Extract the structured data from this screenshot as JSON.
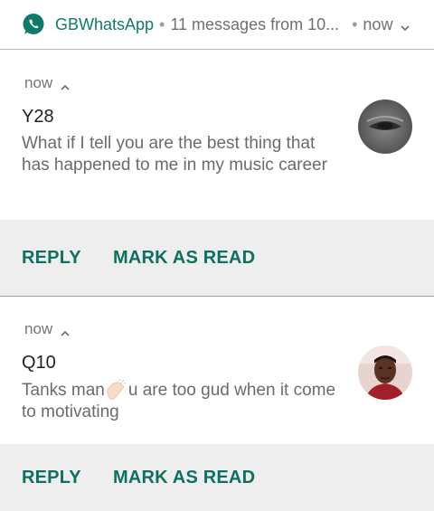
{
  "header": {
    "app_name": "GBWhatsApp",
    "separator": "•",
    "summary": "11 messages from 10...",
    "time": "now",
    "icon": "whatsapp-logo-icon",
    "accent_color": "#0f7a6a"
  },
  "notifications": [
    {
      "time": "now",
      "sender": "Y28",
      "message": "What if I tell you are the best thing that has happened to me in my music career",
      "avatar": "avatar-photo-icon",
      "actions": {
        "reply": "REPLY",
        "mark_read": "MARK AS READ"
      }
    },
    {
      "time": "now",
      "sender": "Q10",
      "message_before": "Tanks man",
      "emoji": "clapping-hands-icon",
      "message_after": "u are too gud when it come to motivating",
      "avatar": "avatar-photo-icon",
      "actions": {
        "reply": "REPLY",
        "mark_read": "MARK AS READ"
      }
    }
  ],
  "colors": {
    "action_text": "#0f6f60",
    "action_bar_bg": "#eeeeee"
  }
}
